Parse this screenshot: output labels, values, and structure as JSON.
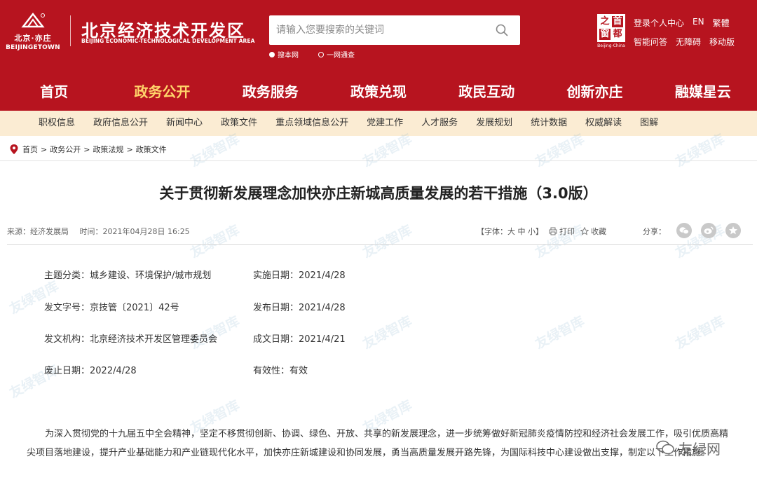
{
  "header": {
    "logo_cn": "北京·亦庄",
    "logo_en": "BEIJINGETOWN",
    "site_name": "北京经济技术开发区",
    "site_name_en": "BEIJING ECONOMIC-TECHNOLOGICAL DEVELOPMENT AREA",
    "search_placeholder": "请输入您要搜索的关键词",
    "search_options": [
      "搜本网",
      "一网通查"
    ],
    "capital_chars": [
      "之",
      "首",
      "窗",
      "都"
    ],
    "capital_caption": "Beijing-China",
    "top_links_row1": [
      "登录个人中心",
      "EN",
      "繁體"
    ],
    "top_links_row2": [
      "智能问答",
      "无障碍",
      "移动版"
    ]
  },
  "main_nav": [
    "首页",
    "政务公开",
    "政务服务",
    "政策兑现",
    "政民互动",
    "创新亦庄",
    "融媒星云"
  ],
  "main_nav_active": "政务公开",
  "sub_nav": [
    "职权信息",
    "政府信息公开",
    "新闻中心",
    "政策文件",
    "重点领域信息公开",
    "党建工作",
    "人才服务",
    "发展规划",
    "统计数据",
    "权威解读",
    "图解"
  ],
  "breadcrumb": [
    "首页",
    "政务公开",
    "政策法规",
    "政策文件"
  ],
  "article": {
    "title": "关于贯彻新发展理念加快亦庄新城高质量发展的若干措施（3.0版）",
    "source": "来源：经济发展局",
    "time": "时间：2021年04月28日 16:25",
    "font_label": "【字体：大 中 小】",
    "print": "打印",
    "favorite": "收藏",
    "share": "分享："
  },
  "info": {
    "topic": "主题分类：城乡建设、环境保护/城市规划",
    "implement_date": "实施日期：2021/4/28",
    "doc_number": "发文字号：京技管〔2021〕42号",
    "publish_date": "发布日期：2021/4/28",
    "issuer": "发文机构：北京经济技术开发区管理委员会",
    "written_date": "成文日期：2021/4/21",
    "expiry_date": "废止日期：2022/4/28",
    "validity": "有效性：有效"
  },
  "body": "为深入贯彻党的十九届五中全会精神，坚定不移贯彻创新、协调、绿色、开放、共享的新发展理念，进一步统筹做好新冠肺炎疫情防控和经济社会发展工作，吸引优质高精尖项目落地建设，提升产业基础能力和产业链现代化水平，加快亦庄新城建设和协同发展，勇当高质量发展开路先锋，为国际科技中心建设做出支撑，制定以下工作措施。",
  "watermark": "友绿智库",
  "corner_watermark": "友绿网",
  "colors": {
    "brand_red": "#b7141f",
    "nav_active": "#ffd36a",
    "subnav_bg": "#fbecd3"
  }
}
